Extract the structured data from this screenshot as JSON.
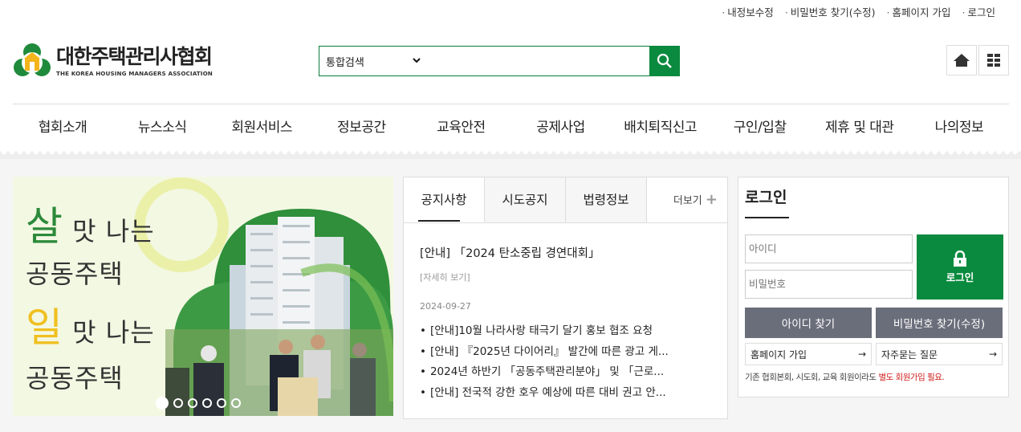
{
  "util_links": [
    "내정보수정",
    "비밀번호 찾기(수정)",
    "홈페이지 가입",
    "로그인"
  ],
  "logo": {
    "ko": "대한주택관리사협회",
    "en": "THE KOREA HOUSING MANAGERS ASSOCIATION",
    "icon": "logo-icon"
  },
  "search": {
    "scope": "통합검색",
    "value": "",
    "icon": "search-icon"
  },
  "top_icons": [
    "home-icon",
    "grid-icon"
  ],
  "nav": [
    "협회소개",
    "뉴스소식",
    "회원서비스",
    "정보공간",
    "교육안전",
    "공제사업",
    "배치퇴직신고",
    "구인/입찰",
    "제휴 및 대관",
    "나의정보"
  ],
  "banner": {
    "line1_big": "살",
    "line1": "맛 나는",
    "line2": "공동주택",
    "line3_big": "일",
    "line3": "맛 나는",
    "line4": "공동주택",
    "active_slide": 1,
    "slide_count": 6
  },
  "notice": {
    "tabs": [
      "공지사항",
      "시도공지",
      "법령정보"
    ],
    "more": "더보기",
    "headline": "[안내] 「2024 탄소중립 경연대회」",
    "detail": "[자세히 보기]",
    "date": "2024-09-27",
    "items": [
      "[안내]10월 나라사랑 태극기 달기 홍보 협조 요청",
      "[안내] 『2025년 다이어리』 발간에 따른 광고 게...",
      "2024년 하반기 「공동주택관리분야」 및 「근로...",
      "[안내] 전국적 강한 호우 예상에 따른 대비 권고 안..."
    ]
  },
  "login": {
    "title": "로그인",
    "id_placeholder": "아이디",
    "pw_placeholder": "비밀번호",
    "button": "로그인",
    "find_id": "아이디 찾기",
    "find_pw": "비밀번호 찾기(수정)",
    "join": "홈페이지 가입",
    "faq": "자주묻는 질문",
    "note_pre": "기존 협회본회, 시도회, 교육 회원이라도 ",
    "note_red": "별도 회원가입 필요."
  }
}
